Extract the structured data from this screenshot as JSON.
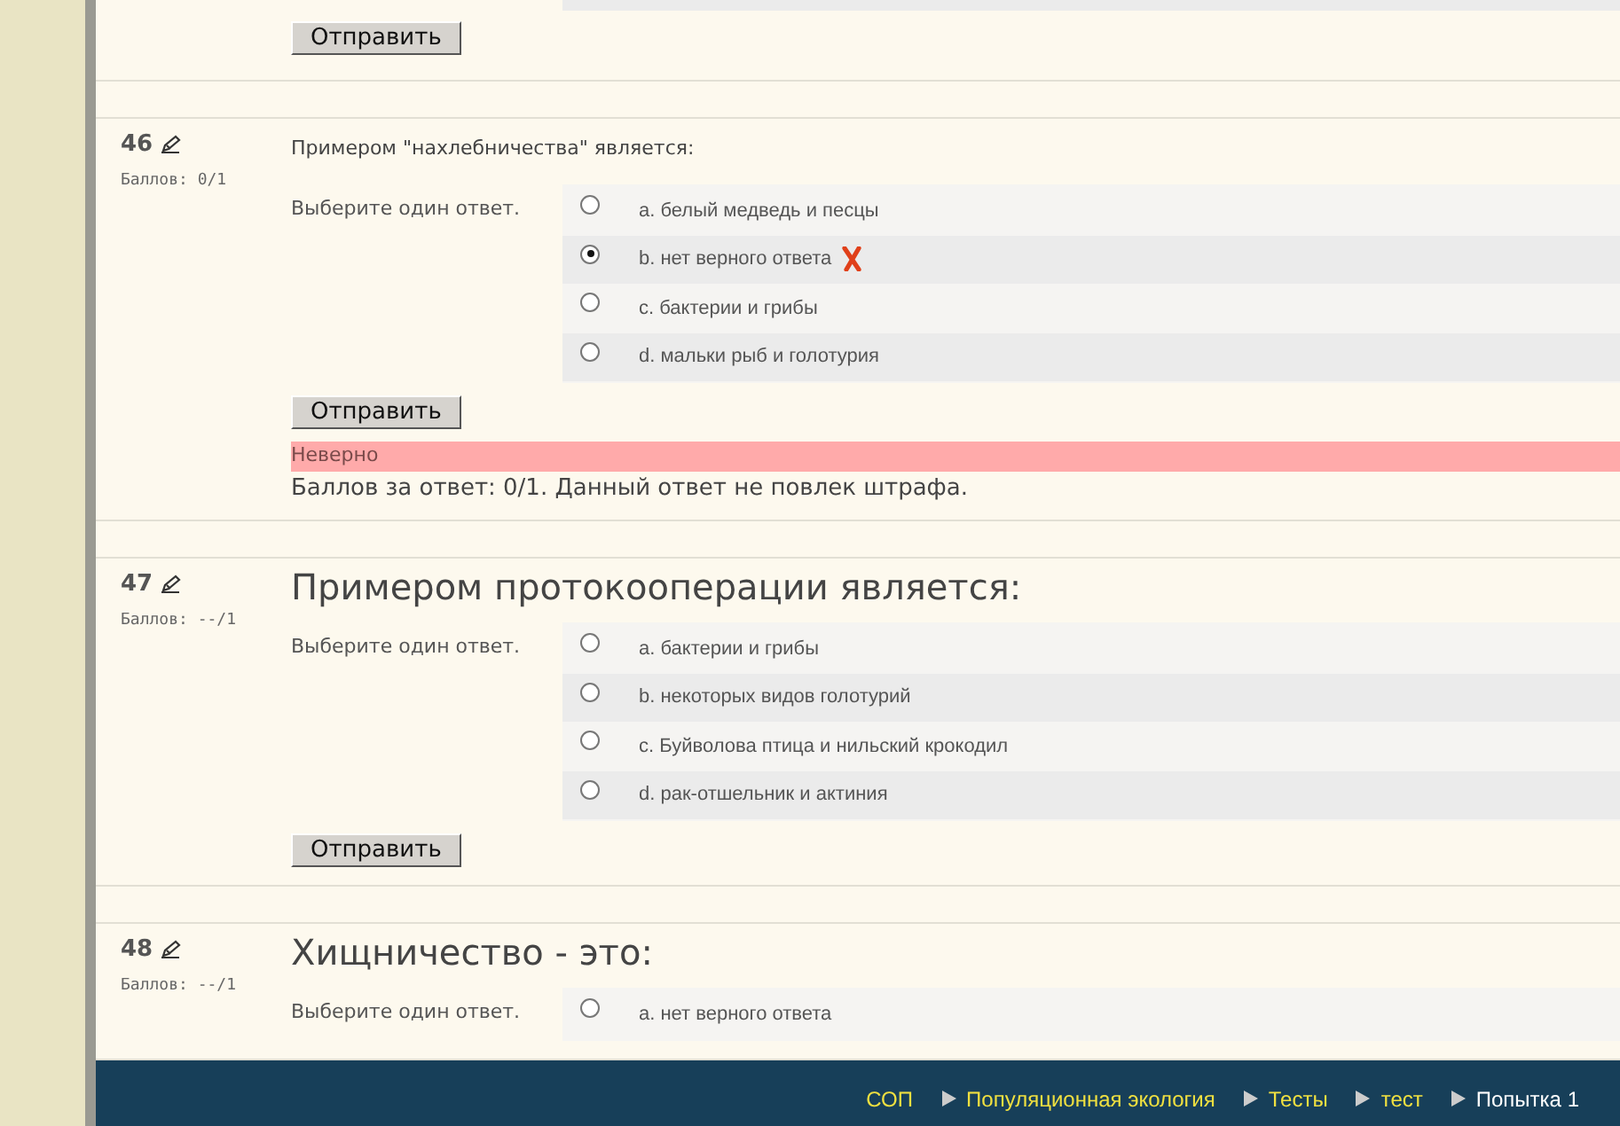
{
  "previous_question": {
    "button": "Отправить"
  },
  "questions": [
    {
      "number": "46",
      "score": "Баллов: 0/1",
      "kind": "plain",
      "text": "Примером \"нахлебничества\" является:",
      "prompt": "Выберите один ответ.",
      "options": [
        {
          "label": "a. белый медведь и песцы",
          "selected": false,
          "wrong": false
        },
        {
          "label": "b. нет верного ответа",
          "selected": true,
          "wrong": true
        },
        {
          "label": "c. бактерии и грибы",
          "selected": false,
          "wrong": false
        },
        {
          "label": "d. мальки рыб и голотурия",
          "selected": false,
          "wrong": false
        }
      ],
      "button": "Отправить",
      "feedback": {
        "status": "Неверно",
        "summary": "Баллов за ответ: 0/1. Данный ответ не повлек штрафа."
      }
    },
    {
      "number": "47",
      "score": "Баллов: --/1",
      "kind": "heading",
      "text": "Примером протокооперации является:",
      "prompt": "Выберите один ответ.",
      "options": [
        {
          "label": "a. бактерии и грибы",
          "selected": false,
          "wrong": false
        },
        {
          "label": "b. некоторых видов голотурий",
          "selected": false,
          "wrong": false
        },
        {
          "label": "c. Буйволова птица и нильский крокодил",
          "selected": false,
          "wrong": false
        },
        {
          "label": "d. рак-отшельник и актиния",
          "selected": false,
          "wrong": false
        }
      ],
      "button": "Отправить"
    },
    {
      "number": "48",
      "score": "Баллов: --/1",
      "kind": "heading",
      "text": "Хищничество - это:",
      "prompt": "Выберите один ответ.",
      "options": [
        {
          "label": "a. нет верного ответа",
          "selected": false,
          "wrong": false
        }
      ]
    }
  ],
  "breadcrumb": [
    {
      "label": "СОП",
      "link": true
    },
    {
      "label": "Популяционная экология",
      "link": true
    },
    {
      "label": "Тесты",
      "link": true
    },
    {
      "label": "тест",
      "link": true
    },
    {
      "label": "Попытка 1",
      "link": false
    }
  ]
}
